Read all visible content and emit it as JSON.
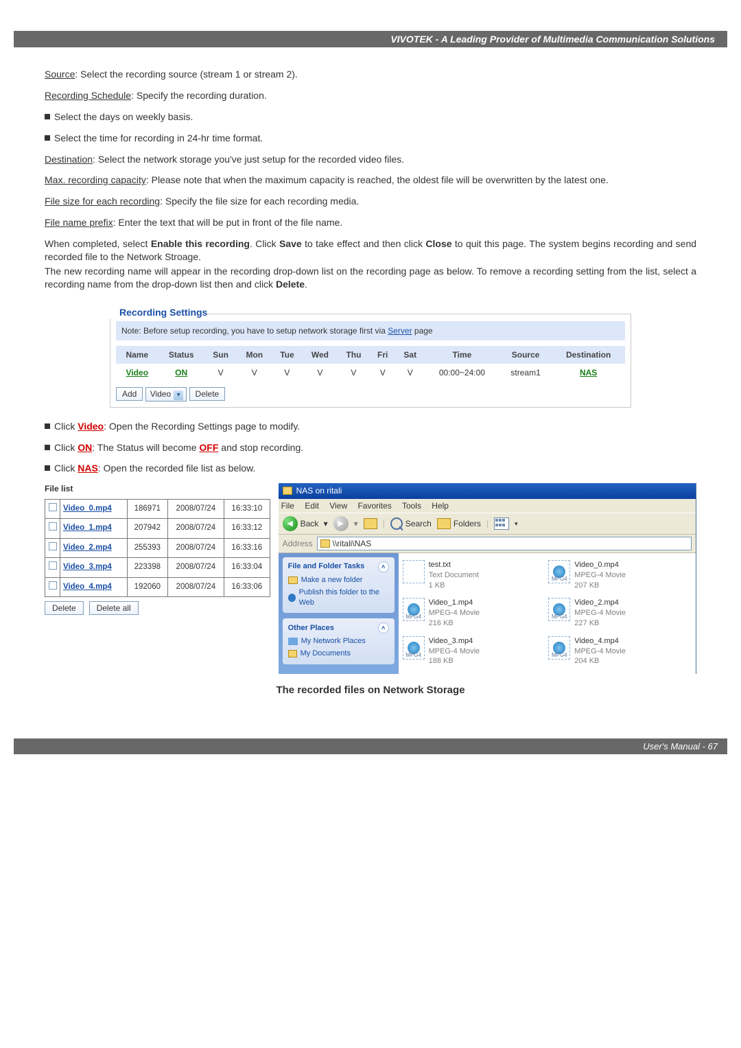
{
  "header": {
    "title": "VIVOTEK - A Leading Provider of Multimedia Communication Solutions"
  },
  "text": {
    "source_label": "Source",
    "source_desc": ": Select the recording source (stream 1 or stream 2).",
    "sched_label": "Recording Schedule",
    "sched_desc": ": Specify the recording duration.",
    "days_bullet": "Select the days on weekly basis.",
    "time_bullet": "Select the time for recording in 24-hr time format.",
    "dest_label": "Destination",
    "dest_desc": ": Select the network storage you've just setup for the recorded video files.",
    "max_label": "Max. recording capacity",
    "max_desc": ": Please note that when the maximum capacity is reached, the oldest file will be overwritten by the latest one.",
    "size_label": "File size for each recording",
    "size_desc": ": Specify the file size for each recording media.",
    "prefix_label": "File name prefix",
    "prefix_desc": ": Enter the text that will be put in front of the file name.",
    "complete_1": "When completed, select ",
    "complete_enable": "Enable this recording",
    "complete_2": ". Click ",
    "complete_save": "Save",
    "complete_3": " to take effect and then click ",
    "complete_close": "Close",
    "complete_4": " to quit this page. The system begins recording and send recorded file to the Network Stroage.",
    "complete_5": "The new recording name will appear in the recording drop-down list on the recording page as below. To remove a recording setting from the list, select a recording name from the drop-down list then and click ",
    "complete_delete": "Delete",
    "complete_6": ".",
    "video_click_1": "Click ",
    "video_link": "Video",
    "video_click_2": ": Open the Recording Settings page to modify.",
    "on_click_1": "Click ",
    "on_link": "ON",
    "on_click_2": ": The Status will become ",
    "off_link": "OFF",
    "on_click_3": " and stop recording.",
    "nas_click_1": "Click ",
    "nas_link": "NAS",
    "nas_click_2": ": Open the recorded file list as below."
  },
  "rec_box": {
    "legend": "Recording Settings",
    "note_pre": "Note: Before setup recording, you have to setup network storage first via ",
    "note_link": "Server",
    "note_post": " page",
    "headers": [
      "Name",
      "Status",
      "Sun",
      "Mon",
      "Tue",
      "Wed",
      "Thu",
      "Fri",
      "Sat",
      "Time",
      "Source",
      "Destination"
    ],
    "row": {
      "name": "Video",
      "status": "ON",
      "days": [
        "V",
        "V",
        "V",
        "V",
        "V",
        "V",
        "V"
      ],
      "time": "00:00~24:00",
      "source": "stream1",
      "dest": "NAS"
    },
    "add_btn": "Add",
    "select": "Video",
    "delete_btn": "Delete"
  },
  "file_list": {
    "title": "File list",
    "rows": [
      {
        "name": "Video_0.mp4",
        "size": "186971",
        "date": "2008/07/24",
        "time": "16:33:10"
      },
      {
        "name": "Video_1.mp4",
        "size": "207942",
        "date": "2008/07/24",
        "time": "16:33:12"
      },
      {
        "name": "Video_2.mp4",
        "size": "255393",
        "date": "2008/07/24",
        "time": "16:33:16"
      },
      {
        "name": "Video_3.mp4",
        "size": "223398",
        "date": "2008/07/24",
        "time": "16:33:04"
      },
      {
        "name": "Video_4.mp4",
        "size": "192060",
        "date": "2008/07/24",
        "time": "16:33:06"
      }
    ],
    "delete_btn": "Delete",
    "delete_all_btn": "Delete all"
  },
  "explorer": {
    "title": "NAS on ritali",
    "menu": [
      "File",
      "Edit",
      "View",
      "Favorites",
      "Tools",
      "Help"
    ],
    "back": "Back",
    "search": "Search",
    "folders": "Folders",
    "address_label": "Address",
    "address_path": "\\\\ritali\\NAS",
    "tasks1_title": "File and Folder Tasks",
    "tasks1_items": [
      "Make a new folder",
      "Publish this folder to the Web"
    ],
    "tasks2_title": "Other Places",
    "tasks2_items": [
      "My Network Places",
      "My Documents"
    ],
    "files": [
      {
        "name": "test.txt",
        "type": "Text Document",
        "size": "1 KB",
        "icon": "txt"
      },
      {
        "name": "Video_0.mp4",
        "type": "MPEG-4 Movie",
        "size": "207 KB",
        "icon": "mpg"
      },
      {
        "name": "Video_1.mp4",
        "type": "MPEG-4 Movie",
        "size": "216 KB",
        "icon": "mpg"
      },
      {
        "name": "Video_2.mp4",
        "type": "MPEG-4 Movie",
        "size": "227 KB",
        "icon": "mpg"
      },
      {
        "name": "Video_3.mp4",
        "type": "MPEG-4 Movie",
        "size": "188 KB",
        "icon": "mpg"
      },
      {
        "name": "Video_4.mp4",
        "type": "MPEG-4 Movie",
        "size": "204 KB",
        "icon": "mpg"
      }
    ]
  },
  "caption": "The recorded files on Network Storage",
  "footer": "User's Manual - 67"
}
